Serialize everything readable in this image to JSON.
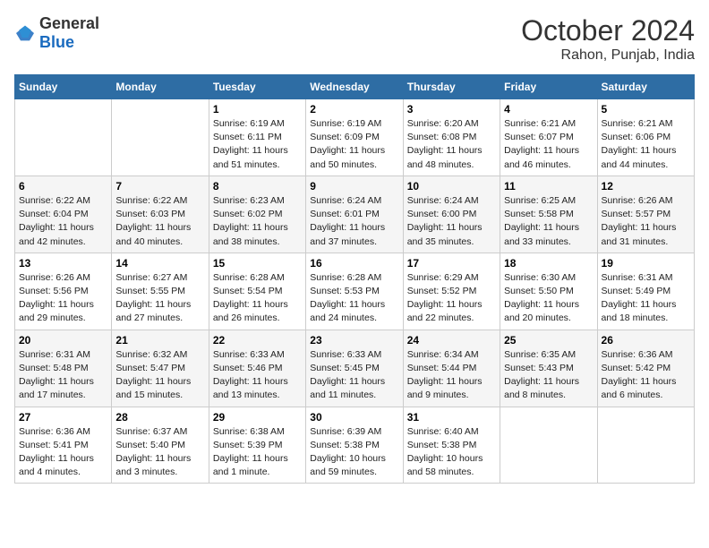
{
  "logo": {
    "general": "General",
    "blue": "Blue"
  },
  "header": {
    "month_year": "October 2024",
    "location": "Rahon, Punjab, India"
  },
  "days_of_week": [
    "Sunday",
    "Monday",
    "Tuesday",
    "Wednesday",
    "Thursday",
    "Friday",
    "Saturday"
  ],
  "weeks": [
    [
      {
        "day": "",
        "detail": ""
      },
      {
        "day": "",
        "detail": ""
      },
      {
        "day": "1",
        "detail": "Sunrise: 6:19 AM\nSunset: 6:11 PM\nDaylight: 11 hours and 51 minutes."
      },
      {
        "day": "2",
        "detail": "Sunrise: 6:19 AM\nSunset: 6:09 PM\nDaylight: 11 hours and 50 minutes."
      },
      {
        "day": "3",
        "detail": "Sunrise: 6:20 AM\nSunset: 6:08 PM\nDaylight: 11 hours and 48 minutes."
      },
      {
        "day": "4",
        "detail": "Sunrise: 6:21 AM\nSunset: 6:07 PM\nDaylight: 11 hours and 46 minutes."
      },
      {
        "day": "5",
        "detail": "Sunrise: 6:21 AM\nSunset: 6:06 PM\nDaylight: 11 hours and 44 minutes."
      }
    ],
    [
      {
        "day": "6",
        "detail": "Sunrise: 6:22 AM\nSunset: 6:04 PM\nDaylight: 11 hours and 42 minutes."
      },
      {
        "day": "7",
        "detail": "Sunrise: 6:22 AM\nSunset: 6:03 PM\nDaylight: 11 hours and 40 minutes."
      },
      {
        "day": "8",
        "detail": "Sunrise: 6:23 AM\nSunset: 6:02 PM\nDaylight: 11 hours and 38 minutes."
      },
      {
        "day": "9",
        "detail": "Sunrise: 6:24 AM\nSunset: 6:01 PM\nDaylight: 11 hours and 37 minutes."
      },
      {
        "day": "10",
        "detail": "Sunrise: 6:24 AM\nSunset: 6:00 PM\nDaylight: 11 hours and 35 minutes."
      },
      {
        "day": "11",
        "detail": "Sunrise: 6:25 AM\nSunset: 5:58 PM\nDaylight: 11 hours and 33 minutes."
      },
      {
        "day": "12",
        "detail": "Sunrise: 6:26 AM\nSunset: 5:57 PM\nDaylight: 11 hours and 31 minutes."
      }
    ],
    [
      {
        "day": "13",
        "detail": "Sunrise: 6:26 AM\nSunset: 5:56 PM\nDaylight: 11 hours and 29 minutes."
      },
      {
        "day": "14",
        "detail": "Sunrise: 6:27 AM\nSunset: 5:55 PM\nDaylight: 11 hours and 27 minutes."
      },
      {
        "day": "15",
        "detail": "Sunrise: 6:28 AM\nSunset: 5:54 PM\nDaylight: 11 hours and 26 minutes."
      },
      {
        "day": "16",
        "detail": "Sunrise: 6:28 AM\nSunset: 5:53 PM\nDaylight: 11 hours and 24 minutes."
      },
      {
        "day": "17",
        "detail": "Sunrise: 6:29 AM\nSunset: 5:52 PM\nDaylight: 11 hours and 22 minutes."
      },
      {
        "day": "18",
        "detail": "Sunrise: 6:30 AM\nSunset: 5:50 PM\nDaylight: 11 hours and 20 minutes."
      },
      {
        "day": "19",
        "detail": "Sunrise: 6:31 AM\nSunset: 5:49 PM\nDaylight: 11 hours and 18 minutes."
      }
    ],
    [
      {
        "day": "20",
        "detail": "Sunrise: 6:31 AM\nSunset: 5:48 PM\nDaylight: 11 hours and 17 minutes."
      },
      {
        "day": "21",
        "detail": "Sunrise: 6:32 AM\nSunset: 5:47 PM\nDaylight: 11 hours and 15 minutes."
      },
      {
        "day": "22",
        "detail": "Sunrise: 6:33 AM\nSunset: 5:46 PM\nDaylight: 11 hours and 13 minutes."
      },
      {
        "day": "23",
        "detail": "Sunrise: 6:33 AM\nSunset: 5:45 PM\nDaylight: 11 hours and 11 minutes."
      },
      {
        "day": "24",
        "detail": "Sunrise: 6:34 AM\nSunset: 5:44 PM\nDaylight: 11 hours and 9 minutes."
      },
      {
        "day": "25",
        "detail": "Sunrise: 6:35 AM\nSunset: 5:43 PM\nDaylight: 11 hours and 8 minutes."
      },
      {
        "day": "26",
        "detail": "Sunrise: 6:36 AM\nSunset: 5:42 PM\nDaylight: 11 hours and 6 minutes."
      }
    ],
    [
      {
        "day": "27",
        "detail": "Sunrise: 6:36 AM\nSunset: 5:41 PM\nDaylight: 11 hours and 4 minutes."
      },
      {
        "day": "28",
        "detail": "Sunrise: 6:37 AM\nSunset: 5:40 PM\nDaylight: 11 hours and 3 minutes."
      },
      {
        "day": "29",
        "detail": "Sunrise: 6:38 AM\nSunset: 5:39 PM\nDaylight: 11 hours and 1 minute."
      },
      {
        "day": "30",
        "detail": "Sunrise: 6:39 AM\nSunset: 5:38 PM\nDaylight: 10 hours and 59 minutes."
      },
      {
        "day": "31",
        "detail": "Sunrise: 6:40 AM\nSunset: 5:38 PM\nDaylight: 10 hours and 58 minutes."
      },
      {
        "day": "",
        "detail": ""
      },
      {
        "day": "",
        "detail": ""
      }
    ]
  ]
}
